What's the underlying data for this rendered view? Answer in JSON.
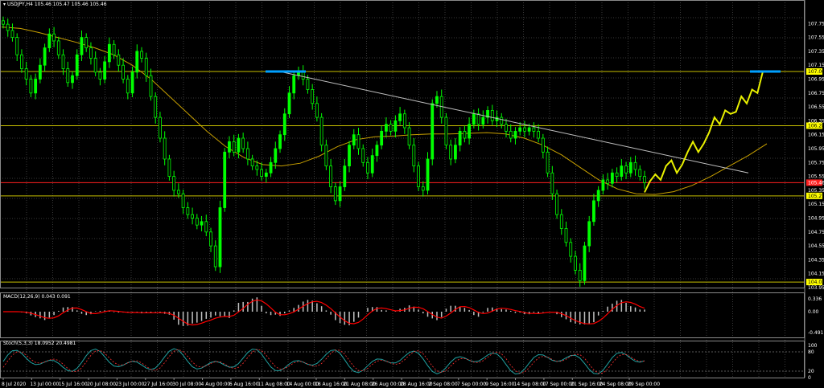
{
  "window": {
    "title": "USDJPY,H4",
    "ohlc": "105.46 105.47 105.46 105.46"
  },
  "indicators": {
    "macd_label": "MACD(12,26,9) 0.043 0.091",
    "stoch_label": "Stoch(5,3,3) 18.0952 20.4981"
  },
  "colors": {
    "background": "#000000",
    "grid": "#3a3a3a",
    "candle_bull": "#00ff00",
    "candle_bear": "#00ff00",
    "ma_line": "#c8a000",
    "level_line": "#c8c000",
    "red_level": "#ff2020",
    "trendline": "#c0c0c0",
    "forecast": "#e8f000",
    "target_marker": "#00a0ff",
    "macd_hist": "#c0c0c0",
    "macd_signal": "#ff0000",
    "stoch_main": "#20a0a0",
    "stoch_signal": "#ff3030",
    "axis_text": "#ffffff"
  },
  "chart_data": {
    "type": "candlestick",
    "main_price_axis": {
      "ticks": [
        "107.75",
        "107.55",
        "107.35",
        "107.15",
        "106.95",
        "106.75",
        "106.55",
        "106.35",
        "106.15",
        "105.95",
        "105.75",
        "105.55",
        "105.35",
        "105.15",
        "104.95",
        "104.75",
        "104.55",
        "104.35",
        "104.15",
        "103.95"
      ],
      "ylim": [
        103.95,
        107.95
      ]
    },
    "levels": [
      {
        "value": 107.06,
        "label": "107.06",
        "color": "#c8c000",
        "label_bg": "#ffff00"
      },
      {
        "value": 106.28,
        "label": "106.28",
        "color": "#c8c000",
        "label_bg": "#ffff00"
      },
      {
        "value": 105.46,
        "label": "105.46",
        "color": "#ff2020",
        "label_bg": "#ff2020"
      },
      {
        "value": 105.27,
        "label": "105.27",
        "color": "#c8c000",
        "label_bg": "#ffff00"
      },
      {
        "value": 104.03,
        "label": "104.03",
        "color": "#c8c000",
        "label_bg": "#ffff00"
      }
    ],
    "close_series": [
      107.74,
      107.65,
      107.55,
      107.3,
      107.1,
      106.95,
      106.75,
      106.95,
      107.15,
      107.4,
      107.6,
      107.5,
      107.3,
      107.1,
      106.9,
      107.0,
      107.3,
      107.55,
      107.4,
      107.25,
      107.05,
      106.95,
      107.2,
      107.45,
      107.3,
      107.15,
      106.95,
      106.75,
      107.05,
      107.35,
      107.25,
      107.0,
      106.7,
      106.4,
      106.1,
      105.8,
      105.55,
      105.35,
      105.3,
      105.1,
      105.0,
      104.95,
      104.85,
      104.9,
      104.75,
      104.55,
      104.25,
      105.1,
      105.9,
      106.05,
      105.9,
      106.1,
      105.95,
      105.8,
      105.7,
      105.65,
      105.55,
      105.6,
      105.75,
      105.95,
      106.15,
      106.45,
      106.75,
      107.0,
      107.05,
      106.95,
      106.8,
      106.6,
      106.4,
      106.0,
      105.7,
      105.4,
      105.2,
      105.4,
      105.7,
      106.0,
      106.15,
      105.95,
      105.75,
      105.6,
      105.85,
      106.0,
      106.2,
      106.3,
      106.2,
      106.35,
      106.45,
      106.25,
      106.0,
      105.7,
      105.4,
      105.35,
      105.8,
      106.6,
      106.7,
      106.4,
      106.0,
      105.8,
      106.0,
      106.2,
      106.1,
      106.3,
      106.45,
      106.3,
      106.4,
      106.5,
      106.35,
      106.4,
      106.3,
      106.2,
      106.1,
      106.2,
      106.25,
      106.2,
      106.25,
      106.2,
      106.1,
      105.9,
      105.6,
      105.3,
      105.0,
      104.8,
      104.6,
      104.4,
      104.2,
      104.05,
      104.55,
      104.9,
      105.2,
      105.35,
      105.5,
      105.45,
      105.6,
      105.55,
      105.7,
      105.6,
      105.75,
      105.65,
      105.55,
      105.46
    ],
    "forecast_series": [
      105.32,
      105.48,
      105.58,
      105.5,
      105.7,
      105.78,
      105.6,
      105.72,
      105.9,
      106.05,
      105.9,
      106.02,
      106.18,
      106.4,
      106.3,
      106.5,
      106.45,
      106.48,
      106.7,
      106.6,
      106.8,
      106.75,
      107.06
    ],
    "ma_series": [
      107.7,
      107.68,
      107.62,
      107.55,
      107.48,
      107.4,
      107.3,
      107.15,
      106.95,
      106.7,
      106.45,
      106.2,
      105.98,
      105.82,
      105.72,
      105.7,
      105.74,
      105.84,
      105.98,
      106.08,
      106.12,
      106.13,
      106.15,
      106.16,
      106.16,
      106.17,
      106.18,
      106.16,
      106.1,
      106.0,
      105.86,
      105.68,
      105.5,
      105.37,
      105.3,
      105.29,
      105.33,
      105.42,
      105.55,
      105.7,
      105.85,
      106.02
    ],
    "trendline": {
      "from": 107.06,
      "to": 105.6
    },
    "target_marker_value": 107.06,
    "x_ticks": [
      "8 Jul 2020",
      "13 Jul 00:00",
      "15 Jul 16:00",
      "20 Jul 08:00",
      "23 Jul 00:00",
      "27 Jul 16:00",
      "30 Jul 08:00",
      "4 Aug 00:00",
      "6 Aug 16:00",
      "11 Aug 08:00",
      "14 Aug 00:00",
      "18 Aug 16:00",
      "21 Aug 08:00",
      "26 Aug 00:00",
      "28 Aug 16:00",
      "2 Sep 08:00",
      "7 Sep 00:00",
      "9 Sep 16:00",
      "14 Sep 08:00",
      "17 Sep 00:00",
      "21 Sep 16:00",
      "24 Sep 08:00",
      "29 Sep 00:00"
    ],
    "macd": {
      "ticks": [
        "0.336",
        "0.00",
        "-0.491"
      ],
      "ylim": [
        -0.491,
        0.336
      ]
    },
    "stoch": {
      "ticks": [
        "100",
        "80",
        "20",
        "0"
      ],
      "ylim": [
        0,
        100
      ]
    }
  }
}
